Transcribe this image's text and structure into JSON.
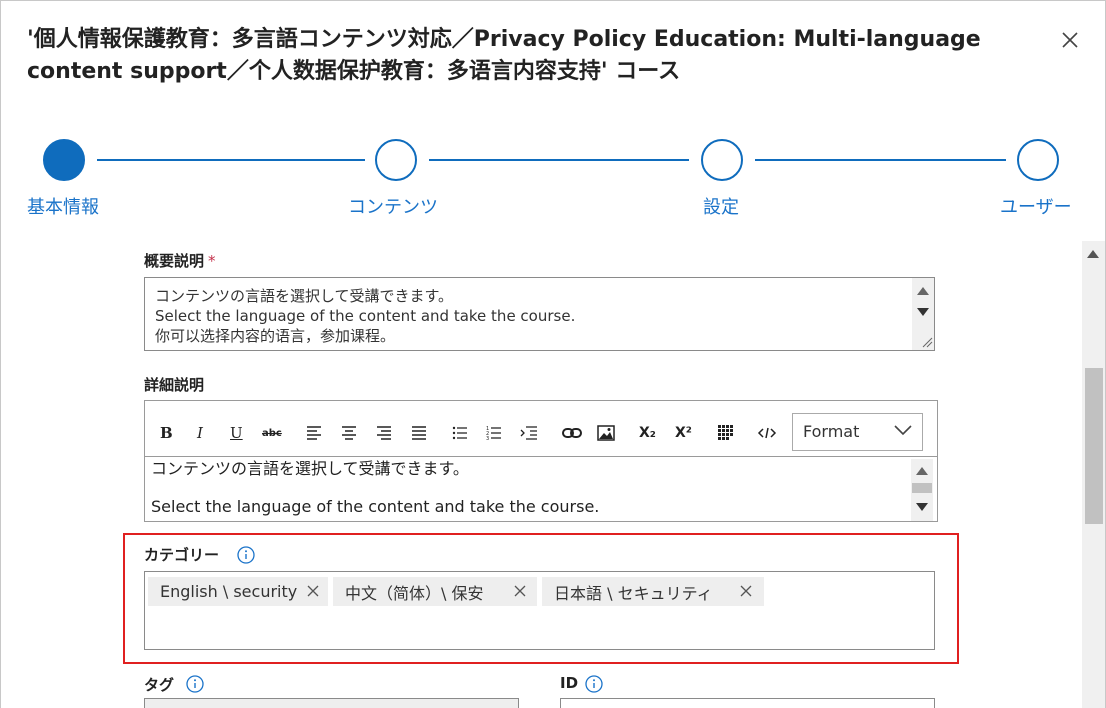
{
  "dialog": {
    "title": "'個人情報保護教育：多言語コンテンツ対応／Privacy Policy Education: Multi-language content support／个人数据保护教育：多语言内容支持' コース",
    "close_icon": "close-icon"
  },
  "stepper": {
    "steps": [
      {
        "label": "基本情報",
        "state": "active"
      },
      {
        "label": "コンテンツ",
        "state": "pending"
      },
      {
        "label": "設定",
        "state": "pending"
      },
      {
        "label": "ユーザー",
        "state": "pending"
      }
    ],
    "accent_color": "#0f6cbd"
  },
  "summary": {
    "label": "概要説明",
    "required_mark": "*",
    "lines": [
      "コンテンツの言語を選択して受講できます。",
      "Select the language of the content and take the course.",
      "你可以选择内容的语言，参加课程。"
    ]
  },
  "details": {
    "label": "詳細説明",
    "toolbar": {
      "bold": "B",
      "italic": "I",
      "underline": "U",
      "strikethrough": "abc",
      "subscript": "X₂",
      "superscript": "X²",
      "format_label": "Format"
    },
    "body_lines": [
      "コンテンツの言語を選択して受講できます。",
      "",
      "Select the language of the content and take the course."
    ]
  },
  "category": {
    "label": "カテゴリー",
    "chips": [
      {
        "label": "English \\ security"
      },
      {
        "label": "中文（简体）\\ 保安"
      },
      {
        "label": "日本語 \\ セキュリティ"
      }
    ],
    "highlight_color": "#e02020"
  },
  "tags": {
    "label": "タグ"
  },
  "id_field": {
    "label": "ID"
  }
}
